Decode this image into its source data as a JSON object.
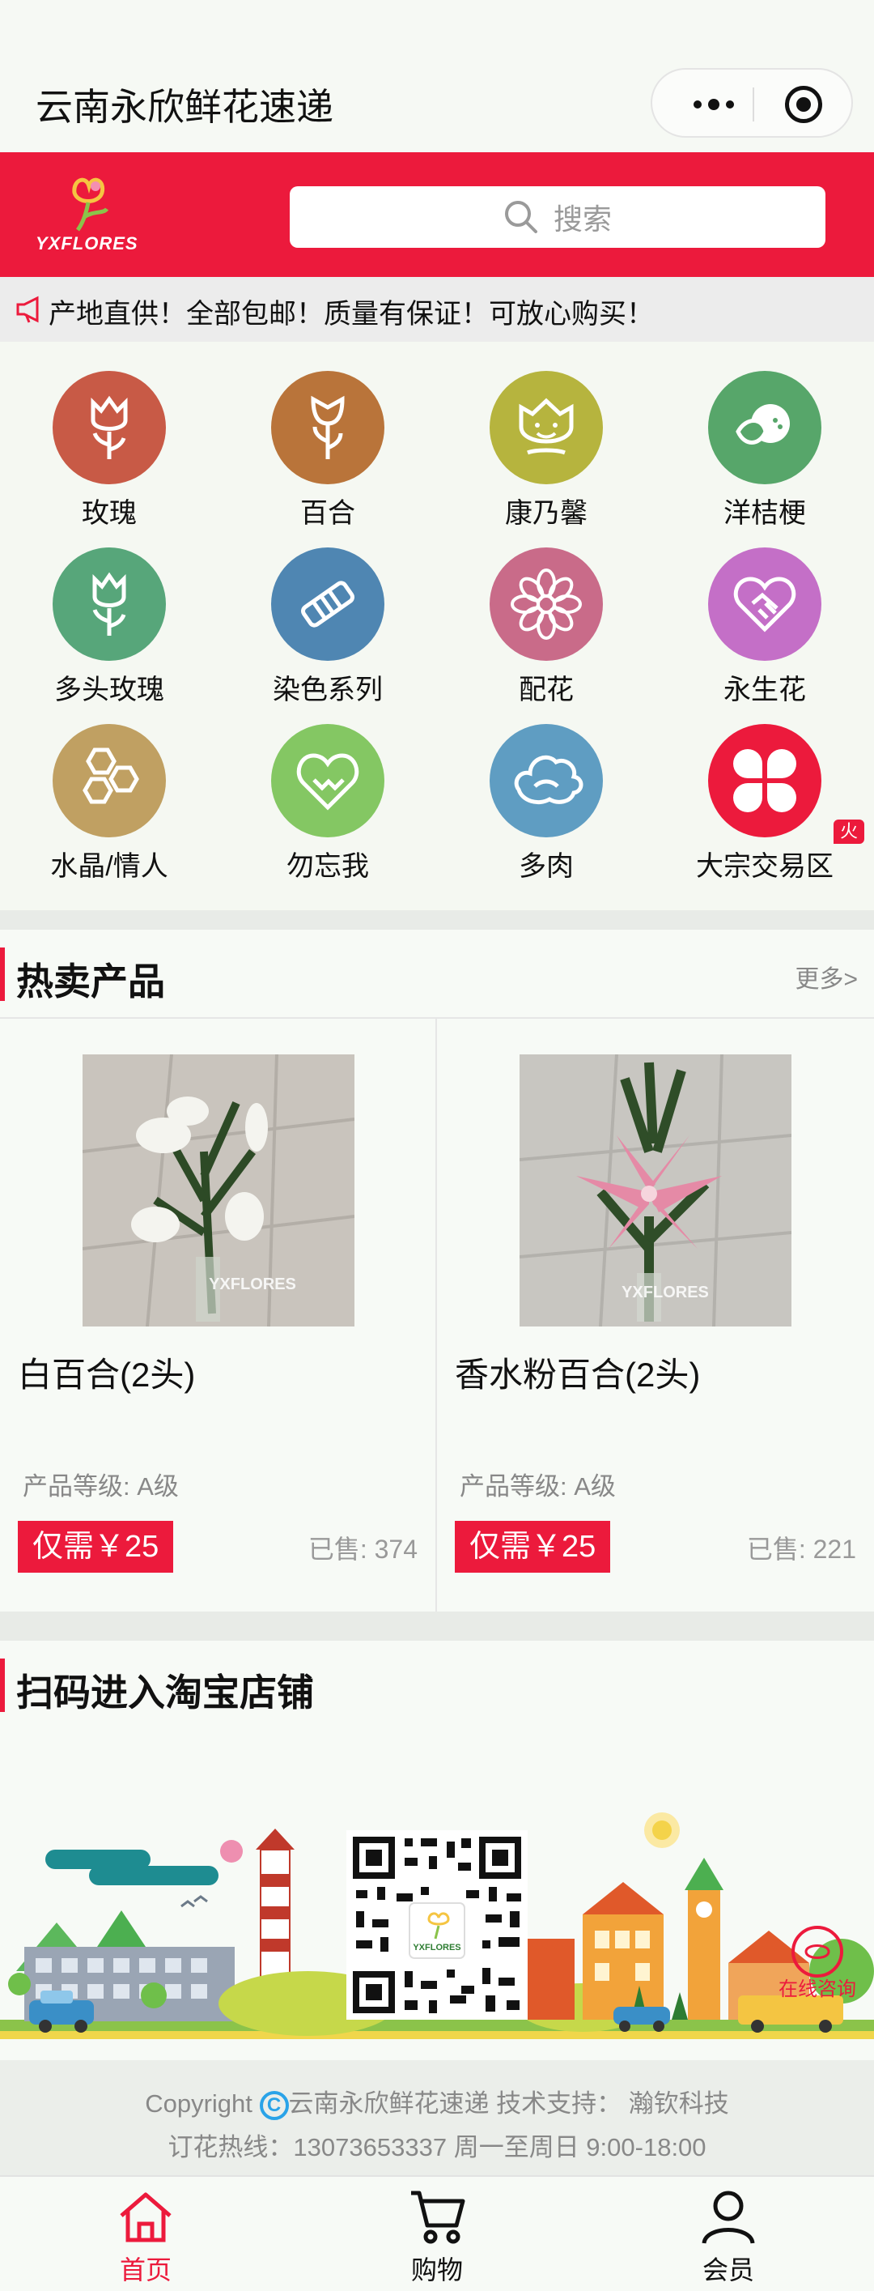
{
  "titlebar": {
    "title": "云南永欣鲜花速递"
  },
  "header": {
    "logo_text": "YXFLORES",
    "search_placeholder": "搜索"
  },
  "notice": {
    "text": "产地直供！全部包邮！质量有保证！可放心购买！"
  },
  "categories": [
    {
      "label": "玫瑰",
      "color": "#c85a46",
      "icon": "rose-icon"
    },
    {
      "label": "百合",
      "color": "#b9743a",
      "icon": "lily-icon"
    },
    {
      "label": "康乃馨",
      "color": "#b6b43e",
      "icon": "carnation-icon"
    },
    {
      "label": "洋桔梗",
      "color": "#57a66a",
      "icon": "eustoma-icon"
    },
    {
      "label": "多头玫瑰",
      "color": "#57a67a",
      "icon": "spray-rose-icon"
    },
    {
      "label": "染色系列",
      "color": "#4f86b2",
      "icon": "dyed-series-icon"
    },
    {
      "label": "配花",
      "color": "#c96b89",
      "icon": "filler-flower-icon"
    },
    {
      "label": "永生花",
      "color": "#c46fc7",
      "icon": "preserved-flower-icon"
    },
    {
      "label": "水晶/情人",
      "color": "#c0a062",
      "icon": "crystal-icon"
    },
    {
      "label": "勿忘我",
      "color": "#84c763",
      "icon": "forget-me-not-icon"
    },
    {
      "label": "多肉",
      "color": "#5f9dc2",
      "icon": "succulent-icon"
    },
    {
      "label": "大宗交易区",
      "color": "#ec1a3c",
      "icon": "wholesale-icon"
    }
  ],
  "hot_badge": "火",
  "hot_section": {
    "title": "热卖产品",
    "more": "更多>"
  },
  "products": [
    {
      "name": "白百合(2头)",
      "grade": "产品等级: A级",
      "price": "仅需￥25",
      "sold": "已售: 374",
      "watermark": "YXFLORES"
    },
    {
      "name": "香水粉百合(2头)",
      "grade": "产品等级: A级",
      "price": "仅需￥25",
      "sold": "已售: 221",
      "watermark": "YXFLORES"
    }
  ],
  "taobao_section": {
    "title": "扫码进入淘宝店铺",
    "qr_logo": "YXFLORES",
    "online": "在线咨询"
  },
  "footer": {
    "copyright_prefix": "Copyright",
    "copyright_text": "云南永欣鲜花速递 技术支持： 瀚钦科技",
    "hotline": "订花热线：13073653337 周一至周日 9:00-18:00"
  },
  "tabs": [
    {
      "label": "首页",
      "active": true
    },
    {
      "label": "购物",
      "active": false
    },
    {
      "label": "会员",
      "active": false
    }
  ],
  "colors": {
    "accent": "#ec1a3c",
    "background": "#f5f8f2"
  }
}
